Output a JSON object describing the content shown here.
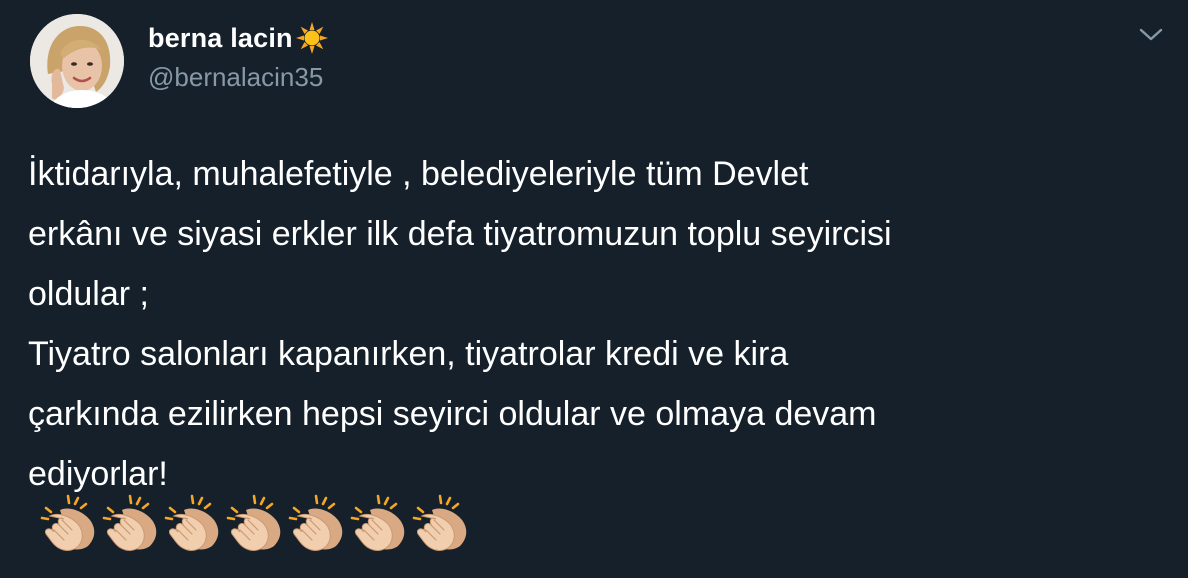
{
  "author": {
    "display_name": "berna lacin",
    "name_emoji": "sun-icon",
    "handle": "@bernalacin35"
  },
  "tweet": {
    "lines": [
      "İktidarıyla, muhalefetiyle , belediyeleriyle tüm Devlet",
      "erkânı ve siyasi erkler ilk defa tiyatromuzun toplu seyircisi",
      "oldular ;",
      "Tiyatro salonları kapanırken, tiyatrolar kredi ve kira",
      "çarkında ezilirken hepsi seyirci oldular ve olmaya devam",
      "ediyorlar!"
    ],
    "emoji_row": [
      "clapping-hands-icon",
      "clapping-hands-icon",
      "clapping-hands-icon",
      "clapping-hands-icon",
      "clapping-hands-icon",
      "clapping-hands-icon",
      "clapping-hands-icon"
    ]
  },
  "colors": {
    "background": "#15202b",
    "text": "#ffffff",
    "secondary_text": "#8899a6"
  }
}
